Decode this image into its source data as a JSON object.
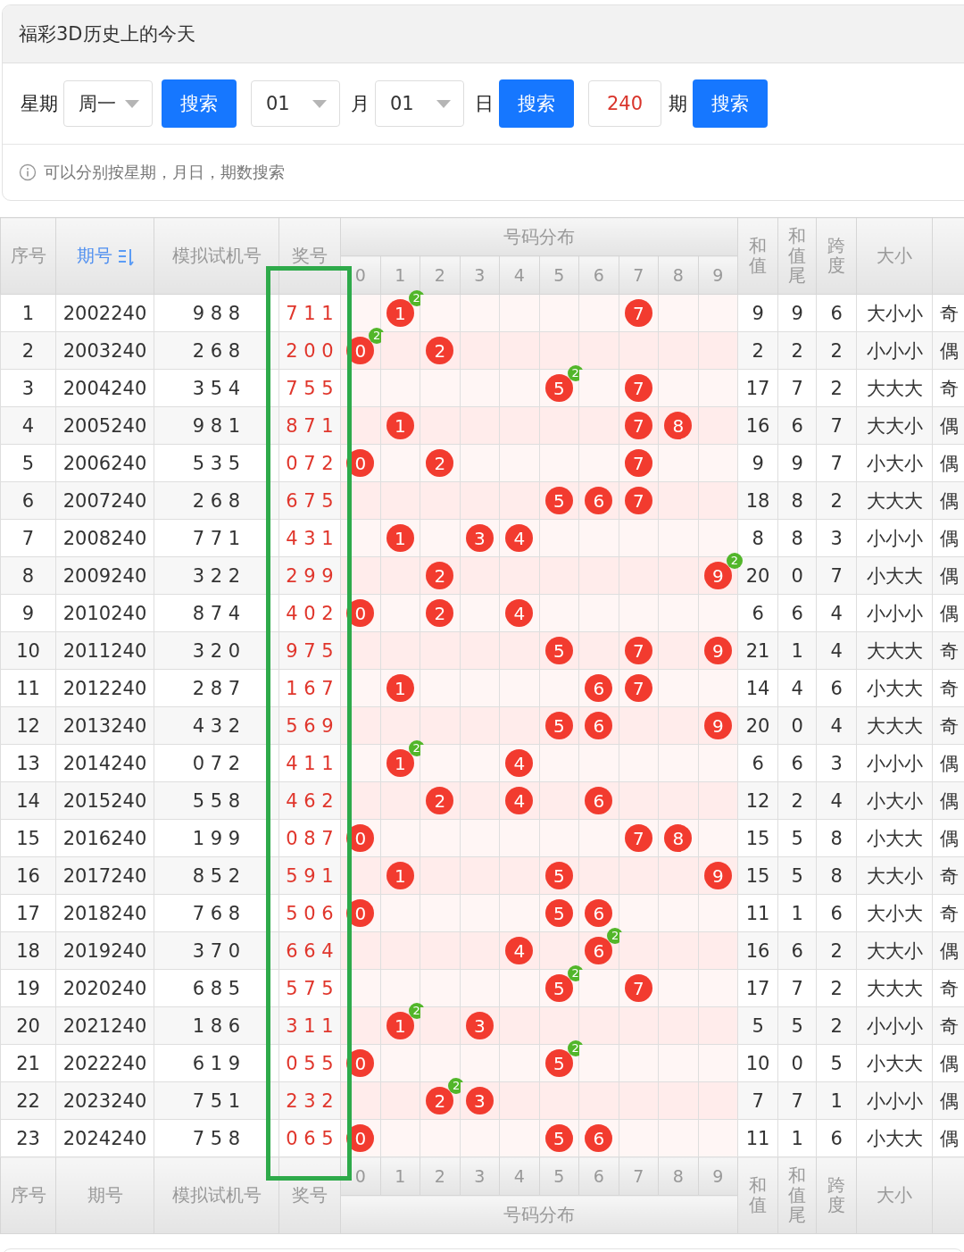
{
  "title": "福彩3D历史上的今天",
  "filters": [
    {
      "kind": "label",
      "text": "星期"
    },
    {
      "kind": "select",
      "value": "周一"
    },
    {
      "kind": "button",
      "text": "搜索"
    },
    {
      "kind": "select",
      "value": "01"
    },
    {
      "kind": "label",
      "text": "月"
    },
    {
      "kind": "select",
      "value": "01"
    },
    {
      "kind": "label",
      "text": "日"
    },
    {
      "kind": "button",
      "text": "搜索"
    },
    {
      "kind": "input",
      "value": "240"
    },
    {
      "kind": "label",
      "text": "期"
    },
    {
      "kind": "button",
      "text": "搜索"
    }
  ],
  "hint": "可以分别按星期，月日，期数搜索",
  "table": {
    "header": [
      {
        "kind": "plain",
        "label": "序号"
      },
      {
        "kind": "plain",
        "label": "期号",
        "sorted": true
      },
      {
        "kind": "plain",
        "label": "模拟试机号"
      },
      {
        "kind": "plain",
        "label": "奖号",
        "highlighted": true
      },
      {
        "kind": "group",
        "label": "号码分布"
      },
      {
        "kind": "stacked",
        "label": "和值"
      },
      {
        "kind": "stacked",
        "label": "和值尾"
      },
      {
        "kind": "stacked",
        "label": "跨度"
      },
      {
        "kind": "plain",
        "label": "大小"
      }
    ],
    "header_digits": [
      "0",
      "1",
      "2",
      "3",
      "4",
      "5",
      "6",
      "7",
      "8",
      "9"
    ],
    "rows": [
      {
        "index": "1",
        "issue": "2002240",
        "trial": "9 8 8",
        "prize": "7 1 1",
        "balls": [
          {
            "value": "1",
            "badge": "2"
          },
          {
            "value": "7"
          }
        ],
        "sum": "9",
        "sum_tail": "9",
        "span": "6",
        "size": "大小小",
        "column_9": "奇"
      },
      {
        "index": "2",
        "issue": "2003240",
        "trial": "2 6 8",
        "prize": "2 0 0",
        "balls": [
          {
            "value": "0",
            "badge": "2"
          },
          {
            "value": "2"
          }
        ],
        "sum": "2",
        "sum_tail": "2",
        "span": "2",
        "size": "小小小",
        "column_9": "偶"
      },
      {
        "index": "3",
        "issue": "2004240",
        "trial": "3 5 4",
        "prize": "7 5 5",
        "balls": [
          {
            "value": "5",
            "badge": "2"
          },
          {
            "value": "7"
          }
        ],
        "sum": "17",
        "sum_tail": "7",
        "span": "2",
        "size": "大大大",
        "column_9": "奇"
      },
      {
        "index": "4",
        "issue": "2005240",
        "trial": "9 8 1",
        "prize": "8 7 1",
        "balls": [
          {
            "value": "1"
          },
          {
            "value": "7"
          },
          {
            "value": "8"
          }
        ],
        "sum": "16",
        "sum_tail": "6",
        "span": "7",
        "size": "大大小",
        "column_9": "偶"
      },
      {
        "index": "5",
        "issue": "2006240",
        "trial": "5 3 5",
        "prize": "0 7 2",
        "balls": [
          {
            "value": "0"
          },
          {
            "value": "2"
          },
          {
            "value": "7"
          }
        ],
        "sum": "9",
        "sum_tail": "9",
        "span": "7",
        "size": "小大小",
        "column_9": "偶"
      },
      {
        "index": "6",
        "issue": "2007240",
        "trial": "2 6 8",
        "prize": "6 7 5",
        "balls": [
          {
            "value": "5"
          },
          {
            "value": "6"
          },
          {
            "value": "7"
          }
        ],
        "sum": "18",
        "sum_tail": "8",
        "span": "2",
        "size": "大大大",
        "column_9": "偶"
      },
      {
        "index": "7",
        "issue": "2008240",
        "trial": "7 7 1",
        "prize": "4 3 1",
        "balls": [
          {
            "value": "1"
          },
          {
            "value": "3"
          },
          {
            "value": "4"
          }
        ],
        "sum": "8",
        "sum_tail": "8",
        "span": "3",
        "size": "小小小",
        "column_9": "偶"
      },
      {
        "index": "8",
        "issue": "2009240",
        "trial": "3 2 2",
        "prize": "2 9 9",
        "balls": [
          {
            "value": "2"
          },
          {
            "value": "9",
            "badge": "2"
          }
        ],
        "sum": "20",
        "sum_tail": "0",
        "span": "7",
        "size": "小大大",
        "column_9": "偶"
      },
      {
        "index": "9",
        "issue": "2010240",
        "trial": "8 7 4",
        "prize": "4 0 2",
        "balls": [
          {
            "value": "0"
          },
          {
            "value": "2"
          },
          {
            "value": "4"
          }
        ],
        "sum": "6",
        "sum_tail": "6",
        "span": "4",
        "size": "小小小",
        "column_9": "偶"
      },
      {
        "index": "10",
        "issue": "2011240",
        "trial": "3 2 0",
        "prize": "9 7 5",
        "balls": [
          {
            "value": "5"
          },
          {
            "value": "7"
          },
          {
            "value": "9"
          }
        ],
        "sum": "21",
        "sum_tail": "1",
        "span": "4",
        "size": "大大大",
        "column_9": "奇"
      },
      {
        "index": "11",
        "issue": "2012240",
        "trial": "2 8 7",
        "prize": "1 6 7",
        "balls": [
          {
            "value": "1"
          },
          {
            "value": "6"
          },
          {
            "value": "7"
          }
        ],
        "sum": "14",
        "sum_tail": "4",
        "span": "6",
        "size": "小大大",
        "column_9": "奇"
      },
      {
        "index": "12",
        "issue": "2013240",
        "trial": "4 3 2",
        "prize": "5 6 9",
        "balls": [
          {
            "value": "5"
          },
          {
            "value": "6"
          },
          {
            "value": "9"
          }
        ],
        "sum": "20",
        "sum_tail": "0",
        "span": "4",
        "size": "大大大",
        "column_9": "奇"
      },
      {
        "index": "13",
        "issue": "2014240",
        "trial": "0 7 2",
        "prize": "4 1 1",
        "balls": [
          {
            "value": "1",
            "badge": "2"
          },
          {
            "value": "4"
          }
        ],
        "sum": "6",
        "sum_tail": "6",
        "span": "3",
        "size": "小小小",
        "column_9": "偶"
      },
      {
        "index": "14",
        "issue": "2015240",
        "trial": "5 5 8",
        "prize": "4 6 2",
        "balls": [
          {
            "value": "2"
          },
          {
            "value": "4"
          },
          {
            "value": "6"
          }
        ],
        "sum": "12",
        "sum_tail": "2",
        "span": "4",
        "size": "小大小",
        "column_9": "偶"
      },
      {
        "index": "15",
        "issue": "2016240",
        "trial": "1 9 9",
        "prize": "0 8 7",
        "balls": [
          {
            "value": "0"
          },
          {
            "value": "7"
          },
          {
            "value": "8"
          }
        ],
        "sum": "15",
        "sum_tail": "5",
        "span": "8",
        "size": "小大大",
        "column_9": "偶"
      },
      {
        "index": "16",
        "issue": "2017240",
        "trial": "8 5 2",
        "prize": "5 9 1",
        "balls": [
          {
            "value": "1"
          },
          {
            "value": "5"
          },
          {
            "value": "9"
          }
        ],
        "sum": "15",
        "sum_tail": "5",
        "span": "8",
        "size": "大大小",
        "column_9": "奇"
      },
      {
        "index": "17",
        "issue": "2018240",
        "trial": "7 6 8",
        "prize": "5 0 6",
        "balls": [
          {
            "value": "0"
          },
          {
            "value": "5"
          },
          {
            "value": "6"
          }
        ],
        "sum": "11",
        "sum_tail": "1",
        "span": "6",
        "size": "大小大",
        "column_9": "奇"
      },
      {
        "index": "18",
        "issue": "2019240",
        "trial": "3 7 0",
        "prize": "6 6 4",
        "balls": [
          {
            "value": "4"
          },
          {
            "value": "6",
            "badge": "2"
          }
        ],
        "sum": "16",
        "sum_tail": "6",
        "span": "2",
        "size": "大大小",
        "column_9": "偶"
      },
      {
        "index": "19",
        "issue": "2020240",
        "trial": "6 8 5",
        "prize": "5 7 5",
        "balls": [
          {
            "value": "5",
            "badge": "2"
          },
          {
            "value": "7"
          }
        ],
        "sum": "17",
        "sum_tail": "7",
        "span": "2",
        "size": "大大大",
        "column_9": "奇"
      },
      {
        "index": "20",
        "issue": "2021240",
        "trial": "1 8 6",
        "prize": "3 1 1",
        "balls": [
          {
            "value": "1",
            "badge": "2"
          },
          {
            "value": "3"
          }
        ],
        "sum": "5",
        "sum_tail": "5",
        "span": "2",
        "size": "小小小",
        "column_9": "奇"
      },
      {
        "index": "21",
        "issue": "2022240",
        "trial": "6 1 9",
        "prize": "0 5 5",
        "balls": [
          {
            "value": "0"
          },
          {
            "value": "5",
            "badge": "2"
          }
        ],
        "sum": "10",
        "sum_tail": "0",
        "span": "5",
        "size": "小大大",
        "column_9": "偶"
      },
      {
        "index": "22",
        "issue": "2023240",
        "trial": "7 5 1",
        "prize": "2 3 2",
        "balls": [
          {
            "value": "2",
            "badge": "2"
          },
          {
            "value": "3"
          }
        ],
        "sum": "7",
        "sum_tail": "7",
        "span": "1",
        "size": "小小小",
        "column_9": "偶"
      },
      {
        "index": "23",
        "issue": "2024240",
        "trial": "7 5 8",
        "prize": "0 6 5",
        "balls": [
          {
            "value": "0"
          },
          {
            "value": "5"
          },
          {
            "value": "6"
          }
        ],
        "sum": "11",
        "sum_tail": "1",
        "span": "6",
        "size": "小大大",
        "column_9": "偶"
      }
    ],
    "footer": [
      {
        "kind": "plain",
        "label": "序号"
      },
      {
        "kind": "plain",
        "label": "期号"
      },
      {
        "kind": "plain",
        "label": "模拟试机号"
      },
      {
        "kind": "plain",
        "label": "奖号"
      },
      {
        "kind": "group",
        "label": "号码分布"
      },
      {
        "kind": "stacked",
        "label": "和值"
      },
      {
        "kind": "stacked",
        "label": "和值尾"
      },
      {
        "kind": "stacked",
        "label": "跨度"
      },
      {
        "kind": "plain",
        "label": "大小"
      }
    ],
    "footer_digits": [
      "0",
      "1",
      "2",
      "3",
      "4",
      "5",
      "6",
      "7",
      "8",
      "9"
    ]
  }
}
